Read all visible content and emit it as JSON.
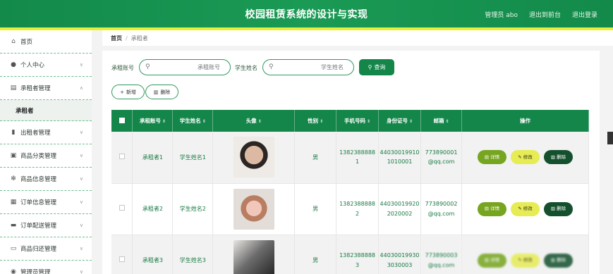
{
  "header": {
    "title": "校园租赁系统的设计与实现",
    "admin": "管理员 abo",
    "back_front": "退出到前台",
    "logout": "退出登录"
  },
  "sidebar": {
    "items": [
      {
        "label": "首页",
        "icon": "home-icon"
      },
      {
        "label": "个人中心",
        "icon": "user-icon"
      },
      {
        "label": "承租者管理",
        "icon": "id-card-icon"
      },
      {
        "label": "出租者管理",
        "icon": "bar-chart-icon"
      },
      {
        "label": "商品分类管理",
        "icon": "shop-icon"
      },
      {
        "label": "商品信息管理",
        "icon": "gear-icon"
      },
      {
        "label": "订单信息管理",
        "icon": "document-icon"
      },
      {
        "label": "订单配送管理",
        "icon": "monitor-icon"
      },
      {
        "label": "商品归还管理",
        "icon": "chat-icon"
      },
      {
        "label": "管理员管理",
        "icon": "admin-icon"
      }
    ],
    "sub_item": "承租者"
  },
  "breadcrumb": {
    "home": "首页",
    "sep": "/",
    "current": "承租者"
  },
  "search": {
    "account_label": "承租账号",
    "account_placeholder": "承租账号",
    "name_label": "学生姓名",
    "name_placeholder": "学生姓名",
    "query_button": "查询"
  },
  "actions": {
    "add": "新增",
    "delete": "删除"
  },
  "table": {
    "headers": [
      "承租账号",
      "学生姓名",
      "头像",
      "性别",
      "手机号码",
      "身份证号",
      "邮箱",
      "操作"
    ],
    "rows": [
      {
        "account": "承租者1",
        "name": "学生姓名1",
        "gender": "男",
        "phone1": "1382388888",
        "phone2": "1",
        "id1": "44030019910",
        "id2": "1010001",
        "mail1": "773890001",
        "mail2": "@qq.com"
      },
      {
        "account": "承租者2",
        "name": "学生姓名2",
        "gender": "男",
        "phone1": "1382388888",
        "phone2": "2",
        "id1": "44030019920",
        "id2": "2020002",
        "mail1": "773890002",
        "mail2": "@qq.com"
      },
      {
        "account": "承租者3",
        "name": "学生姓名3",
        "gender": "男",
        "phone1": "1382388888",
        "phone2": "3",
        "id1": "44030019930",
        "id2": "3030003",
        "mail1": "773890003",
        "mail2": "@qq.com"
      }
    ],
    "op_detail": "详情",
    "op_edit": "修改",
    "op_delete": "删除"
  },
  "colors": {
    "primary": "#14864a",
    "accent": "#e9ef39",
    "detail": "#76a51f",
    "edit": "#e7ec55",
    "delete": "#14502d"
  }
}
